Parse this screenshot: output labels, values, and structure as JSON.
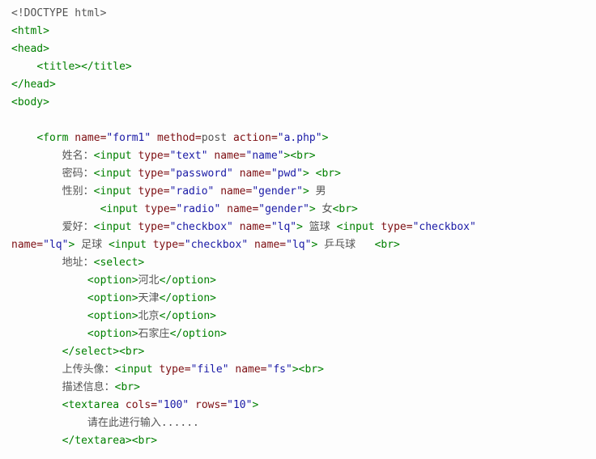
{
  "lines": {
    "l01": "<!DOCTYPE html>",
    "l02": "<html>",
    "l03": "<head>",
    "l04_a": "<title>",
    "l04_b": "</title>",
    "l05": "</head>",
    "l06": "<body>",
    "l07_a": "<form",
    "l07_b": "name=",
    "l07_c": "\"form1\"",
    "l07_d": "method=",
    "l07_e": "post",
    "l07_f": "action=",
    "l07_g": "\"a.php\"",
    "l07_h": ">",
    "l08_a": "姓名：",
    "l08_b": "<input",
    "l08_c": "type=",
    "l08_d": "\"text\"",
    "l08_e": "name=",
    "l08_f": "\"name\"",
    "l08_g": ">",
    "l08_h": "<br>",
    "l09_a": "密码：",
    "l09_b": "<input",
    "l09_c": "type=",
    "l09_d": "\"password\"",
    "l09_e": "name=",
    "l09_f": "\"pwd\"",
    "l09_g": ">",
    "l09_h": "<br>",
    "l10_a": "性别：",
    "l10_b": "<input",
    "l10_c": "type=",
    "l10_d": "\"radio\"",
    "l10_e": "name=",
    "l10_f": "\"gender\"",
    "l10_g": ">",
    "l10_h": " 男",
    "l11_a": "<input",
    "l11_b": "type=",
    "l11_c": "\"radio\"",
    "l11_d": "name=",
    "l11_e": "\"gender\"",
    "l11_f": ">",
    "l11_g": " 女",
    "l11_h": "<br>",
    "l12_a": "爱好：",
    "l12_b": "<input",
    "l12_c": "type=",
    "l12_d": "\"checkbox\"",
    "l12_e": "name=",
    "l12_f": "\"lq\"",
    "l12_g": ">",
    "l12_h": " 篮球 ",
    "l12_i": "<input",
    "l12_j": "type=",
    "l12_k": "\"checkbox\"",
    "l13_a": "name=",
    "l13_b": "\"lq\"",
    "l13_c": ">",
    "l13_d": " 足球 ",
    "l13_e": "<input",
    "l13_f": "type=",
    "l13_g": "\"checkbox\"",
    "l13_h": "name=",
    "l13_i": "\"lq\"",
    "l13_j": ">",
    "l13_k": " 乒乓球   ",
    "l13_l": "<br>",
    "l14_a": "地址：",
    "l14_b": "<select>",
    "l15_a": "<option>",
    "l15_b": "河北",
    "l15_c": "</option>",
    "l16_a": "<option>",
    "l16_b": "天津",
    "l16_c": "</option>",
    "l17_a": "<option>",
    "l17_b": "北京",
    "l17_c": "</option>",
    "l18_a": "<option>",
    "l18_b": "石家庄",
    "l18_c": "</option>",
    "l19_a": "</select>",
    "l19_b": "<br>",
    "l20_a": "上传头像：",
    "l20_b": "<input",
    "l20_c": "type=",
    "l20_d": "\"file\"",
    "l20_e": "name=",
    "l20_f": "\"fs\"",
    "l20_g": ">",
    "l20_h": "<br>",
    "l21_a": "描述信息：",
    "l21_b": "<br>",
    "l22_a": "<textarea",
    "l22_b": "cols=",
    "l22_c": "\"100\"",
    "l22_d": "rows=",
    "l22_e": "\"10\"",
    "l22_f": ">",
    "l23": "请在此进行输入......",
    "l24_a": "</textarea>",
    "l24_b": "<br>"
  }
}
